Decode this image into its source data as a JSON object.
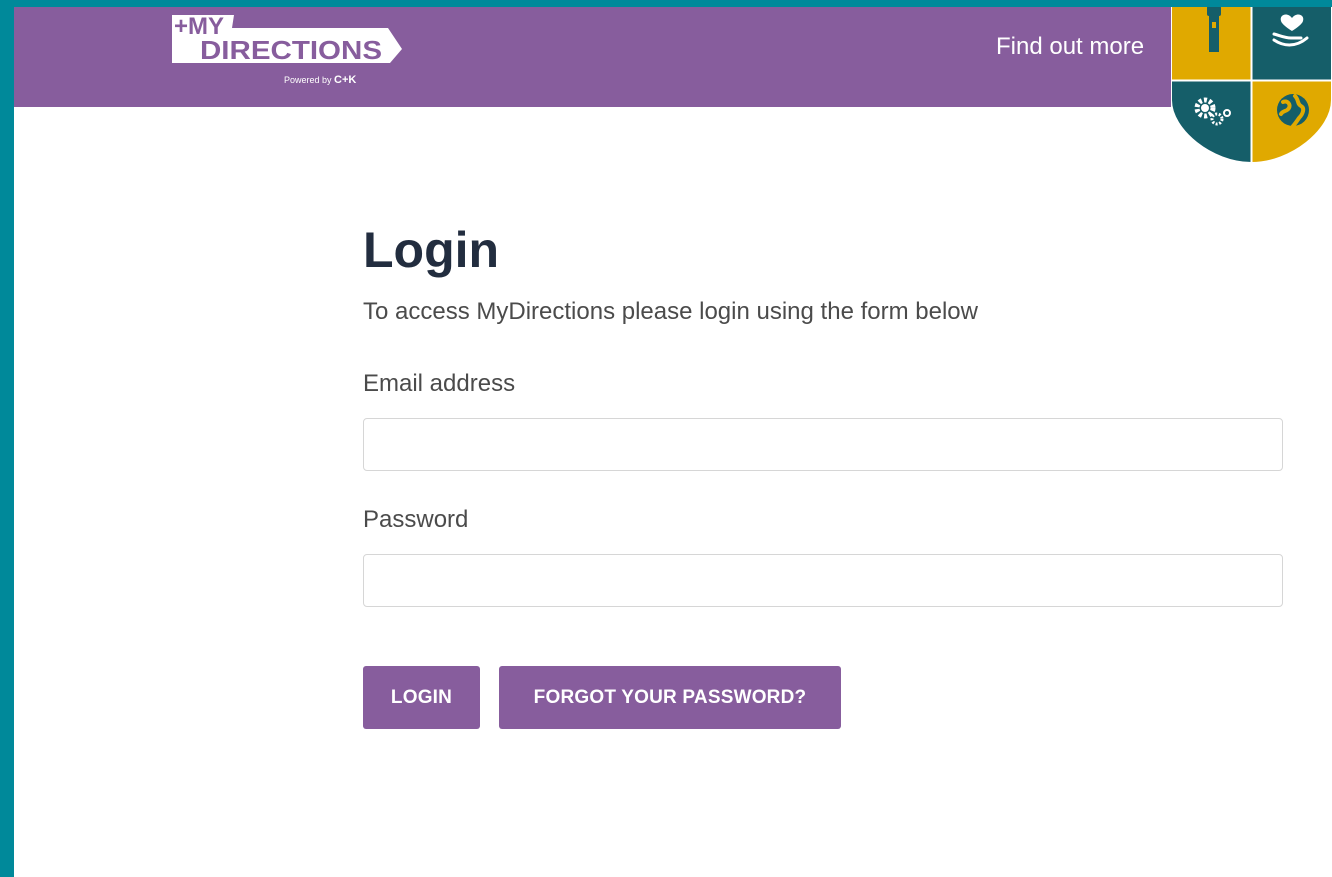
{
  "header": {
    "logo": {
      "line1": "+MY",
      "line2": "DIRECTIONS",
      "powered_prefix": "Powered by",
      "powered_brand": "C+K"
    },
    "find_out_more": "Find out more",
    "emblem_icons": [
      "torch-icon",
      "heart-hand-icon",
      "gears-icon",
      "globe-icon"
    ]
  },
  "login": {
    "title": "Login",
    "intro": "To access MyDirections please login using the form below",
    "email_label": "Email address",
    "email_value": "",
    "password_label": "Password",
    "password_value": "",
    "login_button": "LOGIN",
    "forgot_button": "FORGOT YOUR PASSWORD?"
  },
  "colors": {
    "brand_purple": "#875d9d",
    "page_border": "#00899a",
    "shield_teal": "#155e69",
    "shield_gold": "#e0a900",
    "title_text": "#222d3f"
  }
}
